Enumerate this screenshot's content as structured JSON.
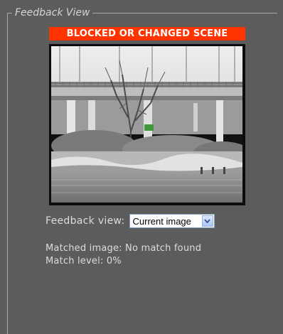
{
  "group": {
    "legend": "Feedback View"
  },
  "alert": {
    "text": "BLOCKED OR CHANGED SCENE",
    "color": "#ff3300"
  },
  "camera": {
    "marker_color": "#3f9a3f"
  },
  "feedback": {
    "label": "Feedback view:",
    "selected": "Current image",
    "icon": "chevron-down-icon"
  },
  "status": {
    "matched_image": "Matched image: No match found",
    "match_level": "Match level: 0%"
  }
}
